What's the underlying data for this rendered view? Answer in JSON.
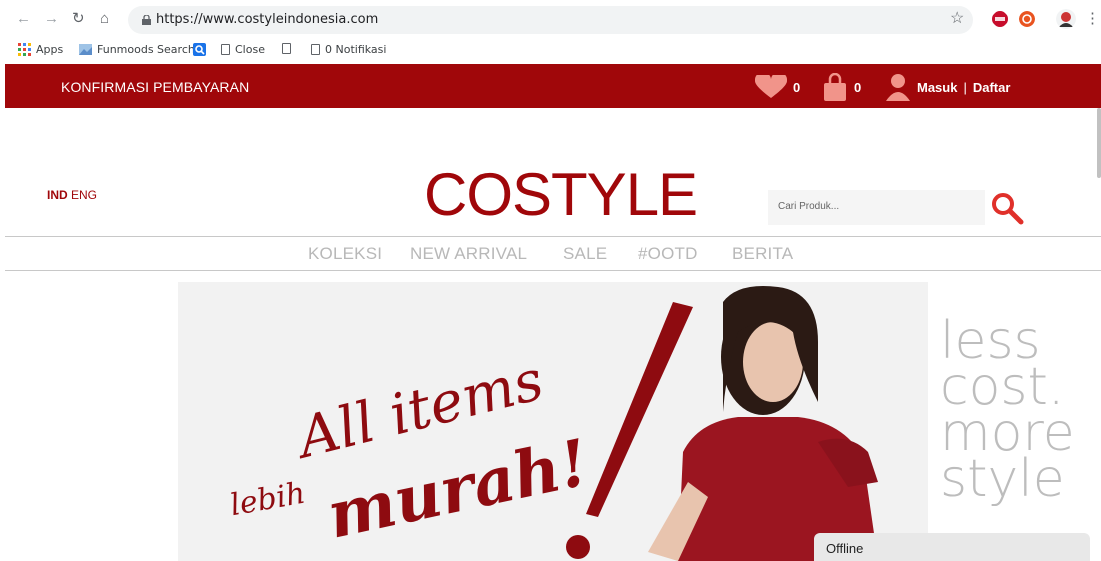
{
  "browser": {
    "url": "https://www.costyleindonesia.com",
    "bookmarks": [
      {
        "label": "Apps"
      },
      {
        "label": "Funmoods Search"
      },
      {
        "label": ""
      },
      {
        "label": "Close"
      },
      {
        "label": ""
      },
      {
        "label": "0 Notifikasi"
      }
    ],
    "extensions": [
      "abp-icon",
      "ublock-icon",
      "profile-avatar-icon"
    ]
  },
  "topbar": {
    "confirm_label": "KONFIRMASI PEMBAYARAN",
    "wishlist_count": "0",
    "cart_count": "0",
    "login_label": "Masuk",
    "separator": "|",
    "register_label": "Daftar"
  },
  "header": {
    "lang_ind": "IND",
    "lang_eng": "ENG",
    "logo_text": "COSTYLE",
    "search_placeholder": "Cari Produk..."
  },
  "menu": [
    "KOLEKSI",
    "NEW ARRIVAL",
    "SALE",
    "#OOTD",
    "BERITA"
  ],
  "banner": {
    "headline_1": "All items",
    "headline_2": "lebih",
    "headline_3": "murah!",
    "tagline": [
      "less",
      "cost.",
      "more",
      "style"
    ]
  },
  "chat": {
    "status": "Offline"
  },
  "colors": {
    "brand": "#a0070a",
    "menu_text": "#b8b8b8",
    "banner_bg": "#f2f2f2"
  }
}
